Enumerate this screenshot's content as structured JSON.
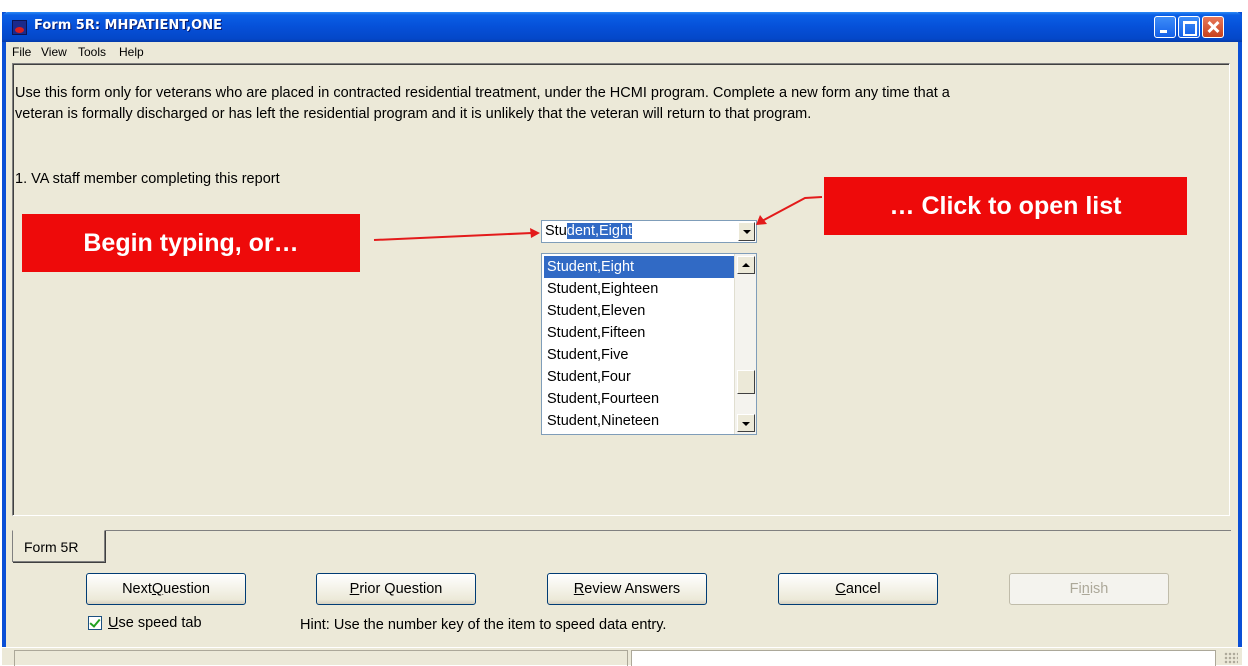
{
  "window": {
    "title": "Form 5R: MHPATIENT,ONE"
  },
  "menu": {
    "items": [
      "File",
      "View",
      "Tools",
      "Help"
    ]
  },
  "form": {
    "intro_line1": "Use this form only for veterans who are placed in contracted residential treatment, under the HCMI program. Complete a new form any time that a",
    "intro_line2": "veteran is formally discharged or has left the residential program and it is unlikely that the veteran will return to that program.",
    "question": "1. VA staff member completing this report",
    "combo_typed": "Stu",
    "combo_autocomplete": "dent,Eight",
    "list": {
      "items": [
        "Student,Eight",
        "Student,Eighteen",
        "Student,Eleven",
        "Student,Fifteen",
        "Student,Five",
        "Student,Four",
        "Student,Fourteen",
        "Student,Nineteen"
      ],
      "selected_index": 0
    }
  },
  "callouts": {
    "left": "Begin typing, or…",
    "right": "… Click to open list"
  },
  "tabs": {
    "active": "Form 5R"
  },
  "buttons": {
    "next": {
      "pre": "Next ",
      "ul": "Q",
      "post": "uestion"
    },
    "prior": {
      "pre": "",
      "ul": "P",
      "post": "rior Question"
    },
    "review": {
      "pre": "",
      "ul": "R",
      "post": "eview Answers"
    },
    "cancel": {
      "pre": "",
      "ul": "C",
      "post": "ancel"
    },
    "finish": {
      "pre": "Fi",
      "ul": "n",
      "post": "ish"
    }
  },
  "speed_tab": {
    "label_ul": "U",
    "label_rest": "se speed tab",
    "checked": true
  },
  "hint": "Hint: Use the number key of the item to speed data entry.",
  "colors": {
    "titlebar": "#0650d8",
    "callout": "#ee0a0a",
    "selection": "#316ac5"
  }
}
